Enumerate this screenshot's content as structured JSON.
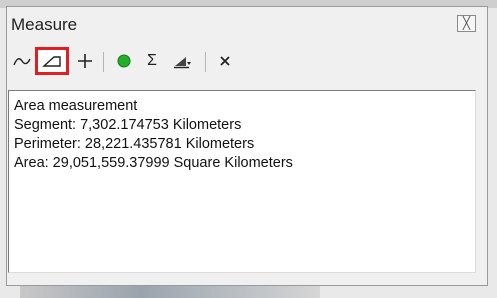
{
  "window": {
    "title": "Measure"
  },
  "toolbar": {
    "tools": [
      {
        "name": "measure-line-tool",
        "icon": "polyline-icon"
      },
      {
        "name": "measure-area-tool",
        "icon": "area-polygon-icon",
        "selected": true
      },
      {
        "name": "measure-feature-tool",
        "icon": "plus-icon"
      },
      {
        "name": "show-total-tool",
        "icon": "green-dot-icon"
      },
      {
        "name": "sum-tool",
        "icon": "sigma-icon"
      },
      {
        "name": "units-dropdown-tool",
        "icon": "units-icon"
      },
      {
        "name": "clear-results-tool",
        "icon": "x-icon"
      }
    ],
    "selected_color": "#e02020",
    "dot_color": "#22b02a"
  },
  "results": {
    "lines": [
      "Area measurement",
      "Segment: 7,302.174753 Kilometers",
      "Perimeter: 28,221.435781 Kilometers",
      "Area: 29,051,559.37999 Square Kilometers"
    ]
  }
}
